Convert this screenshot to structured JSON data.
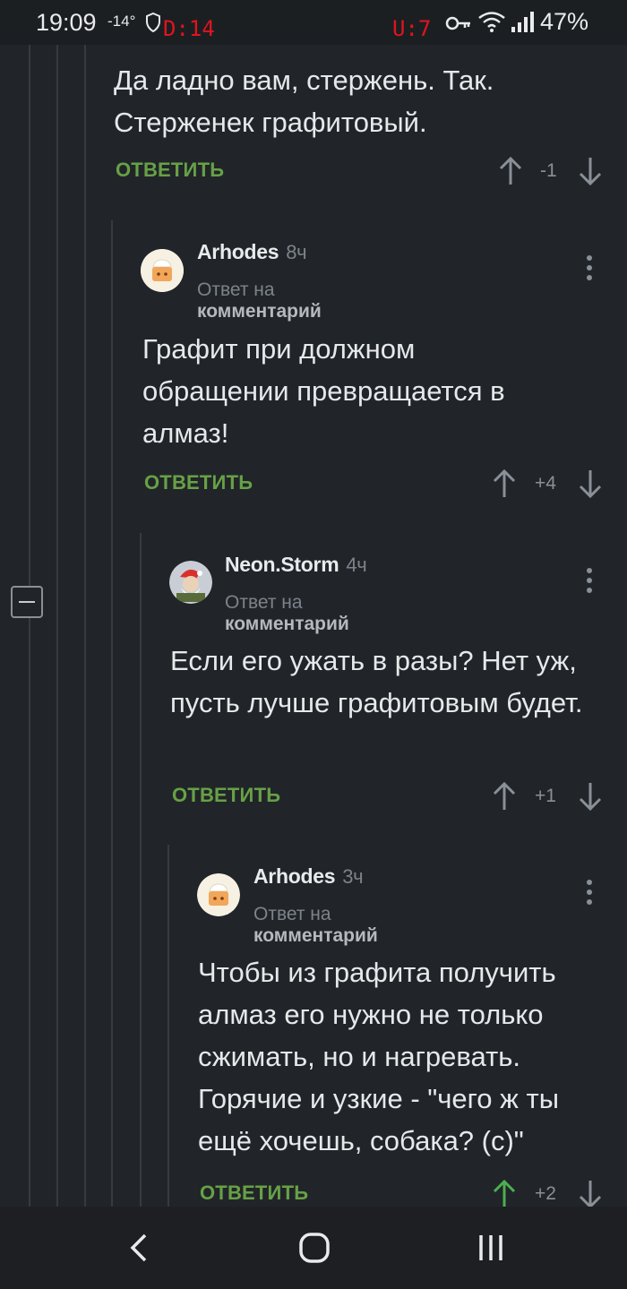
{
  "status_bar": {
    "time": "19:09",
    "temperature": "-14°",
    "debug_d": "D:14",
    "debug_u": "U:7",
    "battery": "47%"
  },
  "colors": {
    "accent_reply": "#67a146",
    "upvoted": "#4caf50",
    "background": "#212529"
  },
  "thread": {
    "top_fragment": {
      "body": "Да ладно вам, стержень. Так. Стерженек графитовый.",
      "reply_label": "ОТВЕТИТЬ",
      "score": "-1"
    },
    "comments": [
      {
        "author": "Arhodes",
        "time": "8ч",
        "reply_prefix": "Ответ на",
        "reply_link": "комментарий",
        "body": "Графит при должном обращении превращается в алмаз!",
        "reply_label": "ОТВЕТИТЬ",
        "score": "+4"
      },
      {
        "author": "Neon.Storm",
        "time": "4ч",
        "reply_prefix": "Ответ на",
        "reply_link": "комментарий",
        "body": "Если его ужать в разы? Нет уж, пусть лучше графитовым будет.",
        "reply_label": "ОТВЕТИТЬ",
        "score": "+1"
      },
      {
        "author": "Arhodes",
        "time": "3ч",
        "reply_prefix": "Ответ на",
        "reply_link": "комментарий",
        "body": "Чтобы из графита получить алмаз его нужно не только сжимать, но и нагревать. Горячие и  узкие - \"чего ж ты ещё хочешь, собака? (с)\"",
        "reply_label": "ОТВЕТИТЬ",
        "score": "+2"
      }
    ]
  },
  "icons": [
    "shield-icon",
    "key-icon",
    "wifi-icon",
    "signal-icon",
    "arrow-up-icon",
    "arrow-down-icon",
    "more-vertical-icon",
    "collapse-icon",
    "back-icon",
    "home-icon",
    "recents-icon"
  ]
}
